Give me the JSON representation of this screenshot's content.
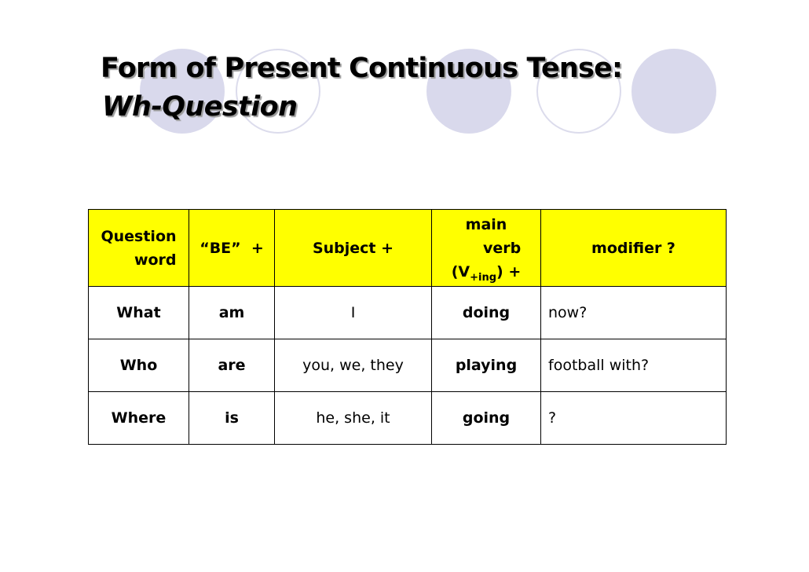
{
  "slide": {
    "title_line1": "Form of Present Continuous Tense:",
    "title_line2": "Wh-Question",
    "decor_colors": {
      "filled_circle": "#d9d9ec",
      "outline_circle": "#dcdcec",
      "header_bg": "#ffff00"
    }
  },
  "table": {
    "headers": {
      "question_word": {
        "line1": "Question",
        "line2": "word"
      },
      "be": "“BE”  +",
      "subject": "Subject +",
      "main_verb": {
        "line1": "main",
        "line2": "verb",
        "prefix": "(V",
        "subscript": "+ing",
        "suffix": ") +"
      },
      "modifier": "modifier ?"
    },
    "rows": [
      {
        "question_word": "What",
        "be": "am",
        "subject": "I",
        "main_verb": "doing",
        "modifier": "now?"
      },
      {
        "question_word": "Who",
        "be": "are",
        "subject": "you, we, they",
        "main_verb": "playing",
        "modifier": "football with?"
      },
      {
        "question_word": "Where",
        "be": "is",
        "subject": "he, she, it",
        "main_verb": "going",
        "modifier": "?"
      }
    ]
  }
}
